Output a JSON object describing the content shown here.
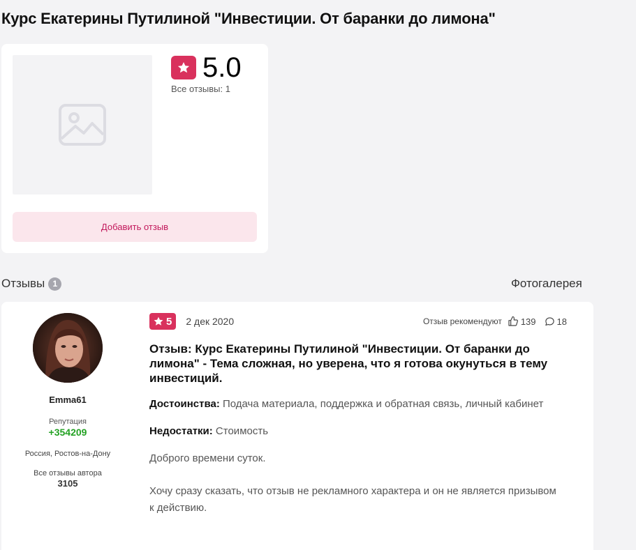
{
  "page": {
    "title": "Курс Екатерины Путилиной \"Инвестиции. От баранки до лимона\""
  },
  "product": {
    "image_icon": "image-placeholder-icon",
    "rating": "5.0",
    "reviews_count_text": "Все отзывы: 1",
    "add_review_label": "Добавить отзыв"
  },
  "reviews_section": {
    "heading": "Отзывы",
    "count": "1",
    "gallery_link": "Фотогалерея"
  },
  "review": {
    "author": {
      "name": "Emma61",
      "reputation_label": "Репутация",
      "reputation_value": "+354209",
      "location": "Россия, Ростов-на-Дону",
      "all_reviews_label": "Все отзывы автора",
      "all_reviews_value": "3105"
    },
    "score": "5",
    "date": "2 дек 2020",
    "recommend_label": "Отзыв рекомендуют",
    "likes": "139",
    "comments": "18",
    "title": "Отзыв: Курс Екатерины Путилиной \"Инвестиции. От баранки до лимона\" - Тема сложная, но уверена, что я готова окунуться в тему инвестиций.",
    "pros_label": "Достоинства:",
    "pros_text": " Подача материала, поддержка и обратная связь, личный кабинет",
    "cons_label": "Недостатки:",
    "cons_text": " Стоимость",
    "paragraph_1": "Доброго времени суток.",
    "paragraph_2": "Хочу сразу сказать, что отзыв не рекламного характера и он не является призывом к действию."
  },
  "colors": {
    "accent": "#d9315d",
    "accent_light": "#fbe6ec",
    "reputation": "#23a123",
    "background": "#f3f3f5"
  }
}
